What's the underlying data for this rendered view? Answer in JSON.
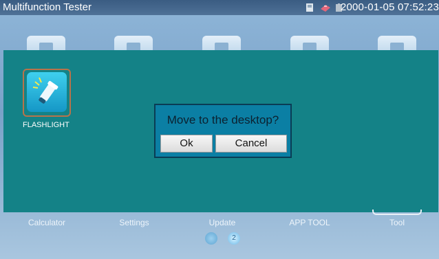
{
  "status_bar": {
    "title": "Multifunction Tester",
    "datetime": "2000-01-05 07:52:23",
    "icons": [
      "sd-card-icon",
      "network-icon",
      "battery-icon"
    ]
  },
  "desktop_app": {
    "label": "FLASHLIGHT",
    "icon": "flashlight-icon"
  },
  "dialog": {
    "message": "Move to the desktop?",
    "ok_label": "Ok",
    "cancel_label": "Cancel"
  },
  "dock": {
    "items": [
      "Calculator",
      "Settings",
      "Update",
      "APP TOOL",
      "Tool"
    ]
  },
  "pager": {
    "current_page": "2"
  },
  "colors": {
    "panel": "#148287",
    "dialog": "#0b7fa4",
    "status_bar": "#3a5c82",
    "frame_highlight": "#b9734a"
  }
}
